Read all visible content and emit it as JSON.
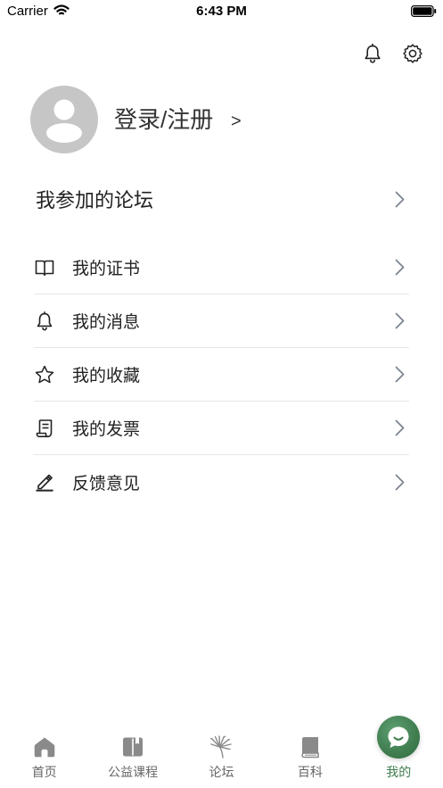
{
  "status_bar": {
    "carrier": "Carrier",
    "time": "6:43 PM"
  },
  "header": {
    "notification_icon": "bell-icon",
    "settings_icon": "gear-icon"
  },
  "profile": {
    "avatar_icon": "person-icon",
    "login_label": "登录/注册",
    "arrow": ">"
  },
  "forum": {
    "label": "我参加的论坛"
  },
  "menu": {
    "items": [
      {
        "label": "我的证书",
        "icon": "book-icon"
      },
      {
        "label": "我的消息",
        "icon": "bell-icon"
      },
      {
        "label": "我的收藏",
        "icon": "star-icon"
      },
      {
        "label": "我的发票",
        "icon": "receipt-icon"
      },
      {
        "label": "反馈意见",
        "icon": "pencil-icon"
      }
    ]
  },
  "tab_bar": {
    "items": [
      {
        "label": "首页",
        "icon": "home-icon"
      },
      {
        "label": "公益课程",
        "icon": "course-book-icon"
      },
      {
        "label": "论坛",
        "icon": "dandelion-icon"
      },
      {
        "label": "百科",
        "icon": "encyclopedia-icon"
      },
      {
        "label": "我的",
        "icon": "chat-bubble-icon",
        "active": true
      }
    ]
  },
  "colors": {
    "accent": "#3f7d4f",
    "text": "#333333",
    "divider": "#e6e6e6",
    "tab_inactive": "#8a8a8a",
    "chevron": "#7d8590",
    "avatar_bg": "#c6c6c6"
  }
}
